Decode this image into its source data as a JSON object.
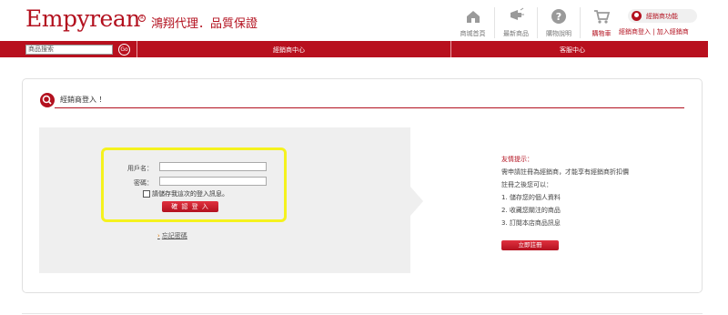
{
  "header": {
    "logo": "Empyrean",
    "logo_mark": "R",
    "tagline": "鴻翔代理．品質保證",
    "nav": [
      {
        "label": "商城首頁",
        "icon": "home-icon"
      },
      {
        "label": "最新商品",
        "icon": "new-products-icon"
      },
      {
        "label": "購物說明",
        "icon": "help-icon"
      },
      {
        "label": "購物車",
        "icon": "cart-icon"
      }
    ],
    "member_button": "經銷商功能",
    "member_links": "經銷商登入 | 加入經銷商"
  },
  "redbar": {
    "search_value": "商品搜索",
    "go_label": "Go",
    "menu_dealer": "經銷商中心",
    "menu_service": "客服中心"
  },
  "login": {
    "section_title": "經銷商登入 ！",
    "username_label": "用戶名：",
    "password_label": "密碼：",
    "remember_label": "請儲存我這次的登入訊息。",
    "confirm_button": "確 認 登 入",
    "forgot_arrow": "›",
    "forgot_link": "忘記密碼"
  },
  "tips": {
    "title": "友情提示：",
    "lines": [
      "需申請註冊為經銷商，才能享有經銷商折扣價",
      "註冊之後您可以：",
      "1. 儲存您的個人資料",
      "2. 收藏您關注的商品",
      "3. 訂閱本店商品訊息"
    ],
    "register_button": "立即註冊"
  },
  "colors": {
    "brand_red": "#b3111f",
    "highlight": "#f5f21e",
    "panel_gray": "#efefef"
  }
}
